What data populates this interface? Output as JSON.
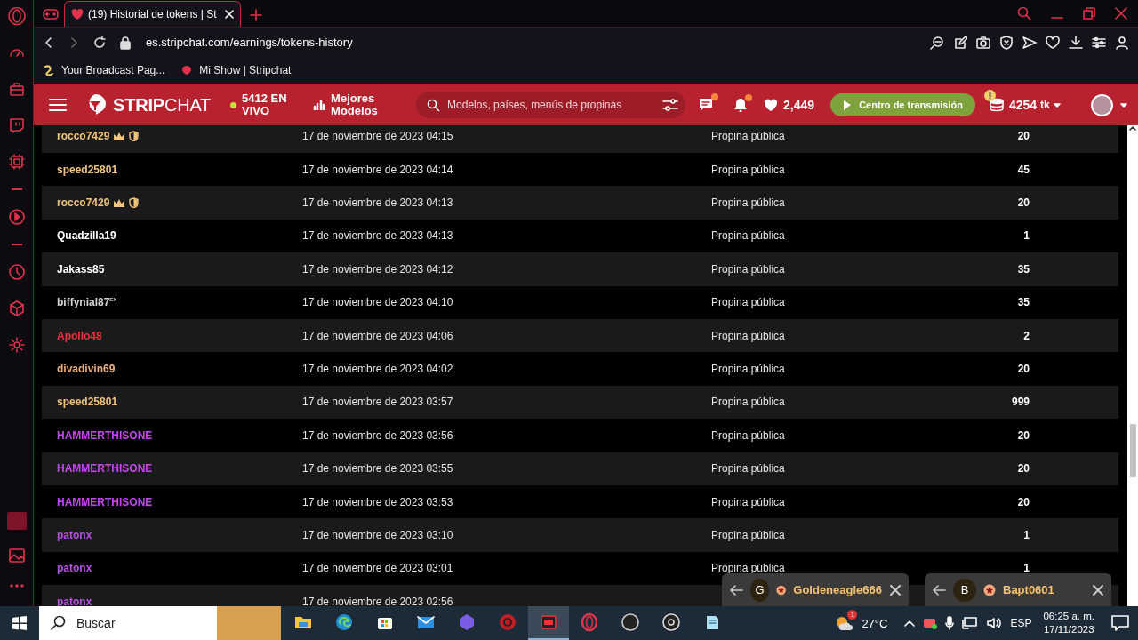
{
  "browser": {
    "tabs": [
      {
        "kind": "icon",
        "selected": false
      },
      {
        "kind": "page",
        "title": "(19) Historial de tokens | St",
        "selected": true
      }
    ],
    "url": "es.stripchat.com/earnings/tokens-history",
    "bookmarks": [
      {
        "label": "Your Broadcast Pag..."
      },
      {
        "label": "Mi Show | Stripchat"
      }
    ]
  },
  "header": {
    "logo": "**STRIP**CHAT",
    "live_count": "5412 EN VIVO",
    "top_models": "Mejores Modelos",
    "search": {
      "placeholder": "Modelos, países, menús de propinas"
    },
    "messages_unread": true,
    "notifications_unread": true,
    "favorites": "2,449",
    "broadcast_button": "Centro de transmisión",
    "tokens_warning": true,
    "tokens": "4254",
    "tokens_unit": "tk"
  },
  "table": {
    "rows": [
      {
        "user": "rocco7429",
        "color": "#f3c57c",
        "badges": [
          {
            "kind": "crown"
          },
          {
            "kind": "shield"
          }
        ],
        "date": "17 de noviembre de 2023 04:15",
        "type": "Propina pública",
        "amount": "20"
      },
      {
        "user": "speed25801",
        "color": "#f2c37e",
        "badges": [],
        "date": "17 de noviembre de 2023 04:14",
        "type": "Propina pública",
        "amount": "45"
      },
      {
        "user": "rocco7429",
        "color": "#f3c57c",
        "badges": [
          {
            "kind": "crown"
          },
          {
            "kind": "shield"
          }
        ],
        "date": "17 de noviembre de 2023 04:13",
        "type": "Propina pública",
        "amount": "20"
      },
      {
        "user": "Quadzilla19",
        "color": "#ffffff",
        "badges": [],
        "date": "17 de noviembre de 2023 04:13",
        "type": "Propina pública",
        "amount": "1"
      },
      {
        "user": "Jakass85",
        "color": "#ffffff",
        "badges": [],
        "date": "17 de noviembre de 2023 04:12",
        "type": "Propina pública",
        "amount": "35"
      },
      {
        "user": "biffynial87$^{EX}$",
        "color": "#d6d6d6",
        "badges": [],
        "date": "17 de noviembre de 2023 04:10",
        "type": "Propina pública",
        "amount": "35"
      },
      {
        "user": "Apollo48",
        "color": "#e8343c",
        "badges": [],
        "date": "17 de noviembre de 2023 04:06",
        "type": "Propina pública",
        "amount": "2"
      },
      {
        "user": "divadivin69",
        "color": "#e9ad7c",
        "badges": [],
        "date": "17 de noviembre de 2023 04:02",
        "type": "Propina pública",
        "amount": "20"
      },
      {
        "user": "speed25801",
        "color": "#f2c37e",
        "badges": [],
        "date": "17 de noviembre de 2023 03:57",
        "type": "Propina pública",
        "amount": "999"
      },
      {
        "user": "HAMMERTHISONE",
        "color": "#c546ee",
        "badges": [],
        "date": "17 de noviembre de 2023 03:56",
        "type": "Propina pública",
        "amount": "20"
      },
      {
        "user": "HAMMERTHISONE",
        "color": "#c546ee",
        "badges": [],
        "date": "17 de noviembre de 2023 03:55",
        "type": "Propina pública",
        "amount": "20"
      },
      {
        "user": "HAMMERTHISONE",
        "color": "#c546ee",
        "badges": [],
        "date": "17 de noviembre de 2023 03:53",
        "type": "Propina pública",
        "amount": "20"
      },
      {
        "user": "patonx",
        "color": "#b84ee6",
        "badges": [],
        "date": "17 de noviembre de 2023 03:10",
        "type": "Propina pública",
        "amount": "1"
      },
      {
        "user": "patonx",
        "color": "#b84ee6",
        "badges": [],
        "date": "17 de noviembre de 2023 03:01",
        "type": "Propina pública",
        "amount": "1"
      },
      {
        "user": "patonx",
        "color": "#b84ee6",
        "badges": [],
        "date": "17 de noviembre de 2023 02:56"
      }
    ]
  },
  "chats": [
    {
      "initial": "G",
      "name": "Goldeneagle666"
    },
    {
      "initial": "B",
      "name": "Bapt0601"
    }
  ],
  "taskbar": {
    "search": {
      "placeholder": "Buscar"
    },
    "apps": [
      {
        "kind": "folder",
        "active": false
      },
      {
        "kind": "edge",
        "active": false
      },
      {
        "kind": "store",
        "active": false
      },
      {
        "kind": "mail",
        "active": false
      },
      {
        "kind": "copilot",
        "active": false
      },
      {
        "kind": "gear",
        "active": false
      },
      {
        "kind": "recorder",
        "active": true
      },
      {
        "kind": "opera",
        "active": false
      },
      {
        "kind": "circle",
        "active": false
      },
      {
        "kind": "obs",
        "active": false
      },
      {
        "kind": "notepad",
        "active": false
      }
    ],
    "weather_badge": "1",
    "temperature": "27°C",
    "language": "ESP",
    "time": "06:25 a. m.",
    "date": "17/11/2023"
  }
}
